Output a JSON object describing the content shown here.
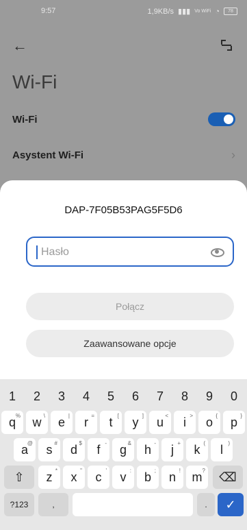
{
  "status": {
    "time": "9:57",
    "speed": "1,9KB/s",
    "signal": "signal-icon",
    "volte": "Vo WiFi",
    "wifi": "wifi-icon",
    "battery": "78"
  },
  "header": {
    "back_icon": "back-arrow-icon",
    "scan_icon": "scan-icon",
    "title": "Wi-Fi"
  },
  "settings": {
    "wifi_label": "Wi-Fi",
    "wifi_enabled": true,
    "assistant_label": "Asystent Wi-Fi"
  },
  "dialog": {
    "ssid": "DAP-7F05B53PAG5F5D6",
    "password_placeholder": "Hasło",
    "password_value": "",
    "connect_label": "Połącz",
    "advanced_label": "Zaawansowane opcje"
  },
  "keyboard": {
    "numbers": [
      "1",
      "2",
      "3",
      "4",
      "5",
      "6",
      "7",
      "8",
      "9",
      "0"
    ],
    "row1": [
      "q",
      "w",
      "e",
      "r",
      "t",
      "y",
      "u",
      "i",
      "o",
      "p"
    ],
    "row1_hints": [
      "%",
      "\\",
      "|",
      "=",
      "[",
      "]",
      "<",
      ">",
      "{",
      "}"
    ],
    "row2": [
      "a",
      "s",
      "d",
      "f",
      "g",
      "h",
      "j",
      "k",
      "l"
    ],
    "row2_hints": [
      "@",
      "#",
      "$",
      "-",
      "&",
      "-",
      "+",
      "(",
      ")"
    ],
    "row3": [
      "z",
      "x",
      "c",
      "v",
      "b",
      "n",
      "m"
    ],
    "row3_hints": [
      "*",
      "\"",
      "'",
      ":",
      ";",
      "!",
      "?"
    ],
    "sym_label": "?123",
    "comma_label": ",",
    "dot_label": ".",
    "shift_icon": "shift-icon",
    "backspace_icon": "backspace-icon",
    "enter_icon": "check-icon"
  },
  "colors": {
    "accent": "#2b66c8",
    "toggle_on": "#1a5fb4"
  }
}
